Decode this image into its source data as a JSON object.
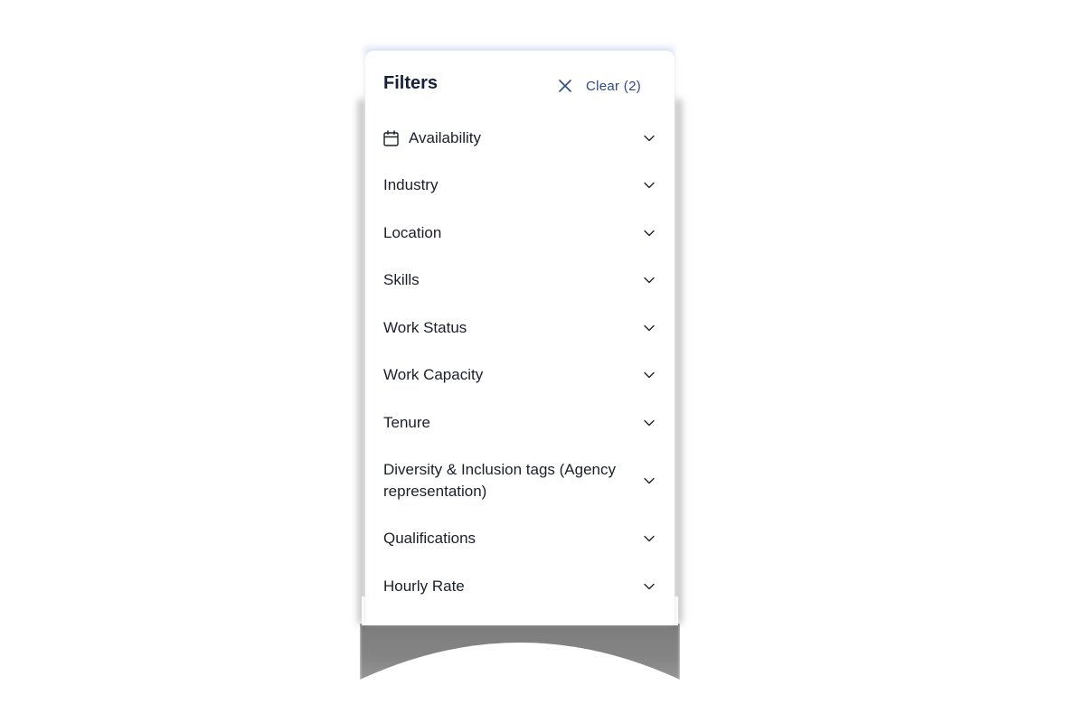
{
  "header": {
    "title": "Filters",
    "clear_label": "Clear (2)"
  },
  "icons": {
    "close": "close-icon",
    "calendar": "calendar-icon",
    "chevron": "chevron-down-icon"
  },
  "colors": {
    "title": "#16203a",
    "accent": "#2d4a8a",
    "text": "#1b1f2a",
    "background": "#ffffff"
  },
  "filters": [
    {
      "label": "Availability",
      "icon": "calendar-icon"
    },
    {
      "label": "Industry"
    },
    {
      "label": "Location"
    },
    {
      "label": "Skills"
    },
    {
      "label": "Work Status"
    },
    {
      "label": "Work Capacity"
    },
    {
      "label": "Tenure"
    },
    {
      "label": "Diversity & Inclusion tags (Agency representation)"
    },
    {
      "label": "Qualifications"
    },
    {
      "label": "Hourly Rate"
    }
  ]
}
